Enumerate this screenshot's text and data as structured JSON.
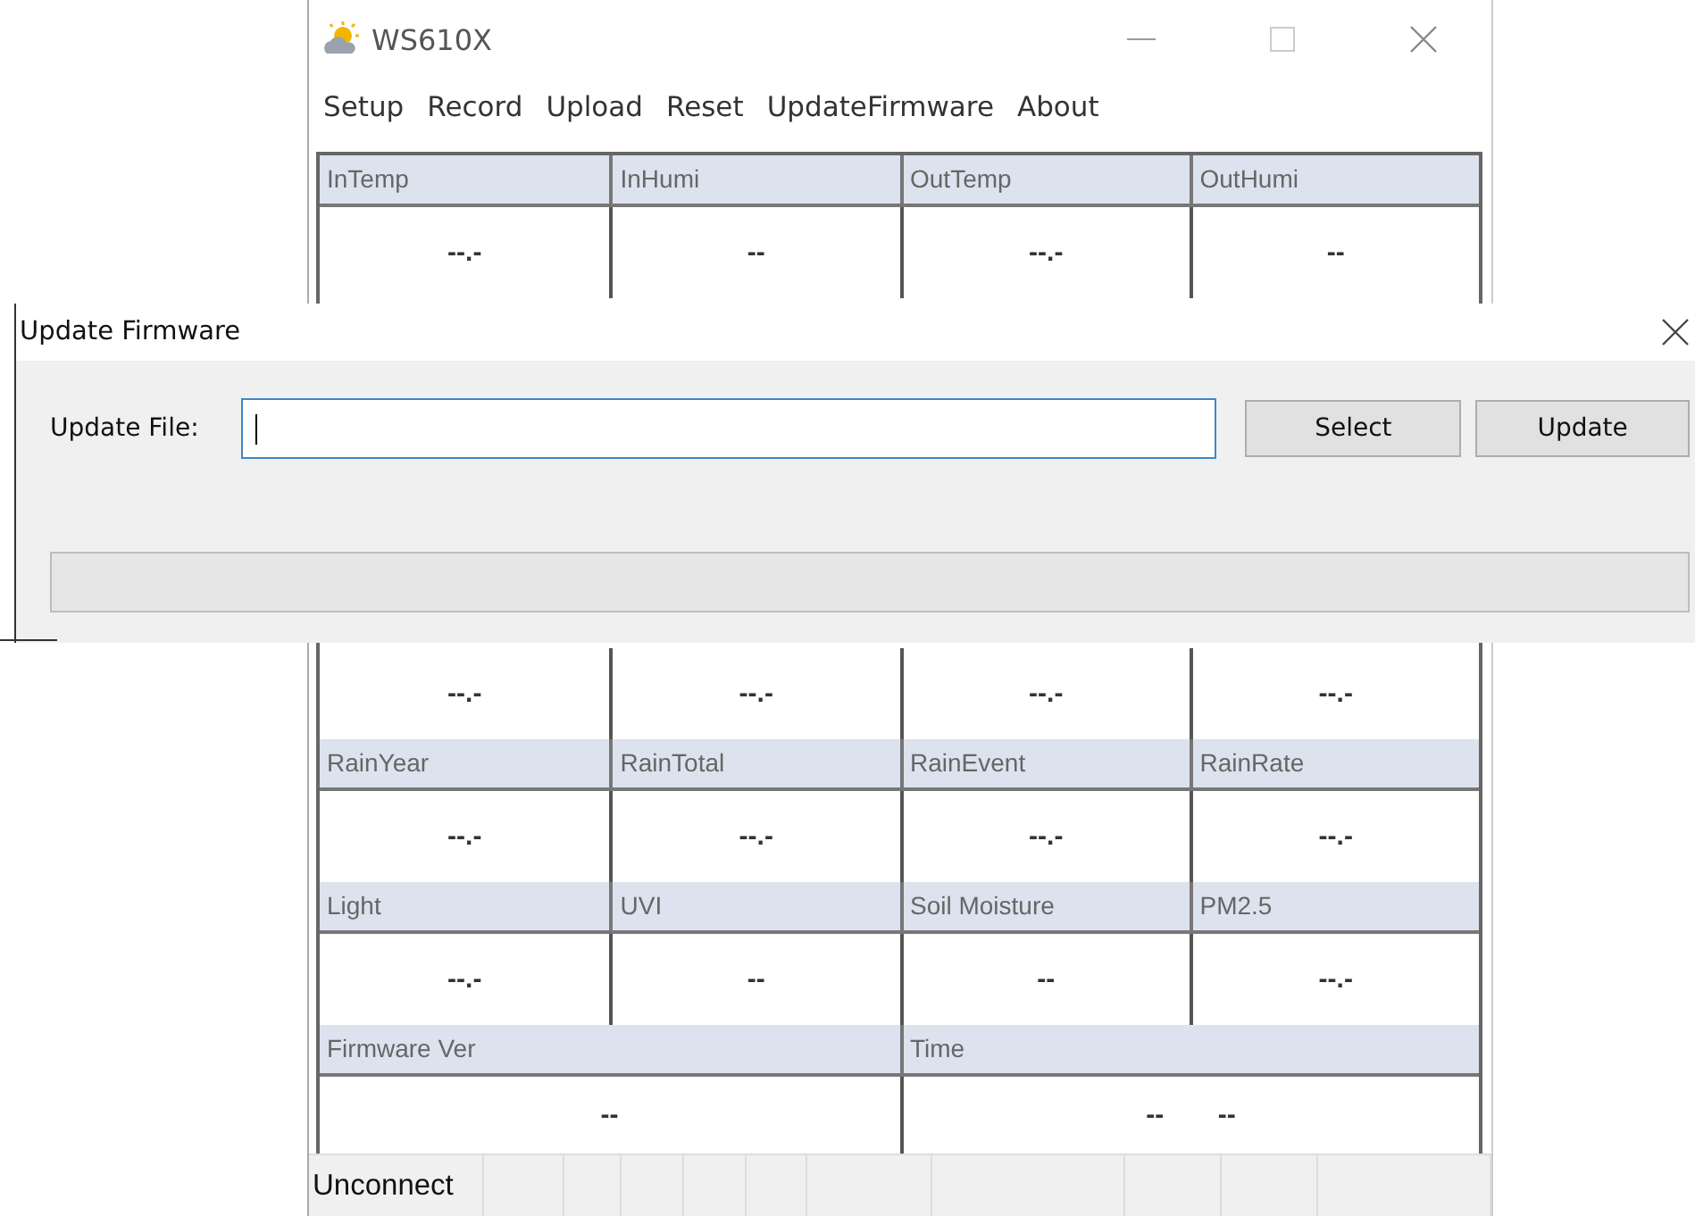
{
  "window": {
    "title": "WS610X"
  },
  "menu": [
    "Setup",
    "Record",
    "Upload",
    "Reset",
    "UpdateFirmware",
    "About"
  ],
  "table": {
    "rows": [
      {
        "kind": "header",
        "cells": [
          "InTemp",
          "InHumi",
          "OutTemp",
          "OutHumi"
        ]
      },
      {
        "kind": "values",
        "cells": [
          "--.-",
          "--",
          "--.-",
          "--"
        ]
      },
      {
        "kind": "values",
        "cells": [
          "--.-",
          "--.-",
          "--.-",
          "--.-"
        ]
      },
      {
        "kind": "header",
        "cells": [
          "RainYear",
          "RainTotal",
          "RainEvent",
          "RainRate"
        ]
      },
      {
        "kind": "values",
        "cells": [
          "--.-",
          "--.-",
          "--.-",
          "--.-"
        ]
      },
      {
        "kind": "header",
        "cells": [
          "Light",
          "UVI",
          "Soil Moisture",
          "PM2.5"
        ]
      },
      {
        "kind": "values",
        "cells": [
          "--.-",
          "--",
          "--",
          "--.-"
        ]
      },
      {
        "kind": "wide_header",
        "cells": [
          "Firmware Ver",
          "Time"
        ]
      },
      {
        "kind": "wide_values",
        "cells": [
          "--",
          "-- --"
        ]
      }
    ]
  },
  "status_bar": [
    "Unconnect"
  ],
  "dialog": {
    "title": "Update Firmware",
    "field_label": "Update File:",
    "buttons": [
      "Select",
      "Update"
    ],
    "progress": {
      "level": 0
    }
  }
}
